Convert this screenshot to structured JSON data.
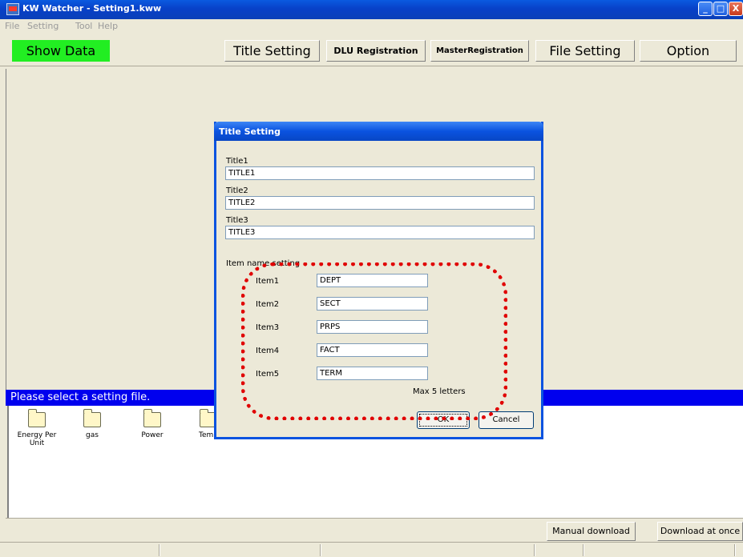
{
  "window": {
    "title": "KW Watcher - Setting1.kww"
  },
  "menu": [
    "File",
    "Setting",
    "Tool",
    "Help"
  ],
  "toolbar": {
    "show_data": "Show Data",
    "title_setting": "Title Setting",
    "dlu_registration": "DLU Registration",
    "master_registration": "MasterRegistration",
    "file_setting": "File Setting",
    "option": "Option"
  },
  "status_message": "Please select a setting file.",
  "files": [
    {
      "name": "Energy Per Unit",
      "icon": "folder-icon"
    },
    {
      "name": "gas",
      "icon": "folder-icon"
    },
    {
      "name": "Power",
      "icon": "folder-icon"
    },
    {
      "name": "Temp",
      "icon": "folder-icon"
    }
  ],
  "bottom": {
    "manual_download": "Manual download",
    "download_at_once": "Download at once"
  },
  "dialog": {
    "title": "Title Setting",
    "title1_label": "Title1",
    "title1_value": "TITLE1",
    "title2_label": "Title2",
    "title2_value": "TITLE2",
    "title3_label": "Title3",
    "title3_value": "TITLE3",
    "item_section_label": "Item name setting",
    "items": [
      {
        "label": "Item1",
        "value": "DEPT"
      },
      {
        "label": "Item2",
        "value": "SECT"
      },
      {
        "label": "Item3",
        "value": "PRPS"
      },
      {
        "label": "Item4",
        "value": "FACT"
      },
      {
        "label": "Item5",
        "value": "TERM"
      }
    ],
    "max_note": "Max 5 letters",
    "ok": "OK",
    "cancel": "Cancel"
  },
  "colors": {
    "accent_green": "#22ee22",
    "status_blue": "#0000ee",
    "highlight_red": "#e00000"
  }
}
